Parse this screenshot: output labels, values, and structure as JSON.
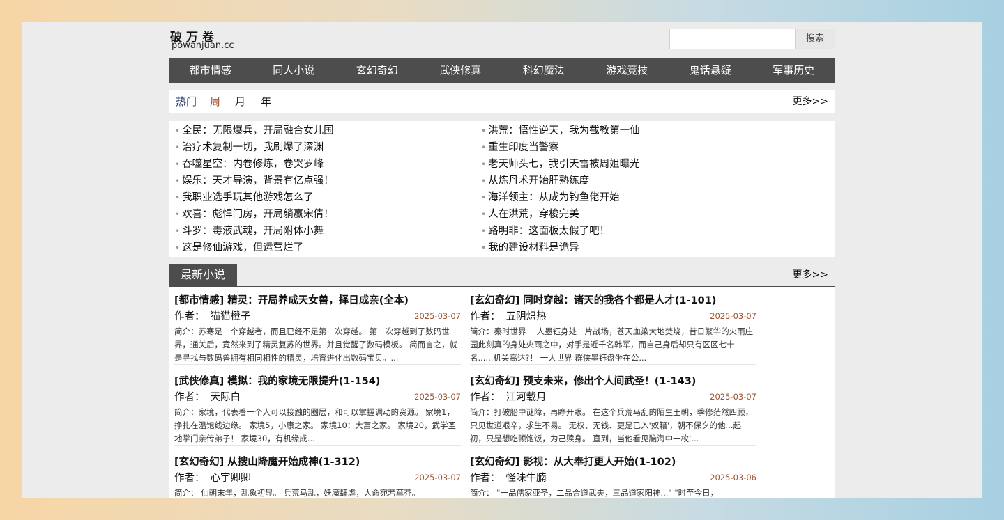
{
  "site": {
    "logo_zh": "破万卷",
    "logo_en": "powanjuan.cc"
  },
  "search": {
    "placeholder": "",
    "button_label": "搜索"
  },
  "nav": [
    "都市情感",
    "同人小说",
    "玄幻奇幻",
    "武侠修真",
    "科幻魔法",
    "游戏竞技",
    "鬼话悬疑",
    "军事历史"
  ],
  "hot": {
    "tabs": {
      "hot": "热门",
      "week": "周",
      "month": "月",
      "year": "年"
    },
    "more": "更多>>",
    "left": [
      "全民：无限爆兵，开局融合女儿国",
      "治疗术复制一切，我刷爆了深渊",
      "吞噬星空：内卷修炼，卷哭罗峰",
      "娱乐：天才导演，背景有亿点强！",
      "我职业选手玩其他游戏怎么了",
      "欢喜：彪悍门房，开局躺赢宋倩！",
      "斗罗：毒液武魂，开局附体小舞",
      "这是修仙游戏，但运营烂了"
    ],
    "right": [
      "洪荒：悟性逆天，我为截教第一仙",
      "重生印度当警察",
      "老天师头七，我引天雷被周姐曝光",
      "从炼丹术开始肝熟练度",
      "海洋领主：从成为钓鱼佬开始",
      "人在洪荒，穿梭完美",
      "路明非：这面板太假了吧！",
      "我的建设材料是诡异"
    ]
  },
  "latest": {
    "title": "最新小说",
    "more": "更多>>",
    "author_label": "作者：",
    "books": [
      {
        "title": "[都市情感] 精灵：开局养成天女兽，择日成亲(全本)",
        "author": "猫猫橙子",
        "date": "2025-03-07",
        "intro": "简介：苏寒是一个穿越者，而且已经不是第一次穿越。 第一次穿越到了数码世界，通关后，竟然来到了精灵复苏的世界。并且觉醒了数码模板。 简而言之，就是寻找与数码兽拥有相同相性的精灵，培育进化出数码宝贝。..."
      },
      {
        "title": "[玄幻奇幻] 同时穿越：诸天的我各个都是人才(1-101)",
        "author": "五阴炽热",
        "date": "2025-03-07",
        "intro": "简介：秦时世界 一人墨钰身处一片战场，苍天血染大地焚烧，昔日繁华的火雨庄园此刻真的身处火雨之中，对手是近千名韩军，而自己身后却只有区区七十二名......机关高达?！ 一人世界 群侠墨钰盘坐在公..."
      },
      {
        "title": "[武侠修真] 模拟：我的家境无限提升(1-154)",
        "author": "天际白",
        "date": "2025-03-07",
        "intro": "简介：家境，代表着一个人可以接触的圈层，和可以掌握调动的资源。 家境1，挣扎在温饱线边缘。 家境5，小康之家。 家境10：大富之家。 家境20，武学圣地掌门亲传弟子！ 家境30，有机缘成..."
      },
      {
        "title": "[玄幻奇幻] 预支未来，修出个人间武圣！(1-143)",
        "author": "江河载月",
        "date": "2025-03-07",
        "intro": "简介：打破胎中谜障，再睁开眼。 在这个兵荒马乱的陌生王朝，季修茫然四顾，只见世道艰辛，求生不易。 无权、无钱、更是已入'奴籍'，朝不保夕的他...起初，只是想吃顿饱饭，为己赎身。 直到，当他看见脑海中一枚'..."
      },
      {
        "title": "[玄幻奇幻] 从搜山降魔开始成神(1-312)",
        "author": "心宇卿卿",
        "date": "2025-03-07",
        "intro": "简介： 仙朝末年，乱象初显。 兵荒马乱，妖魔肆虐，人命宛若草芥。"
      },
      {
        "title": "[玄幻奇幻] 影视：从大奉打更人开始(1-102)",
        "author": "怪味牛腩",
        "date": "2025-03-06",
        "intro": "简介： \"一品儒家亚圣，二品合道武夫，三品道家阳神...\" \"时至今日，"
      }
    ]
  }
}
